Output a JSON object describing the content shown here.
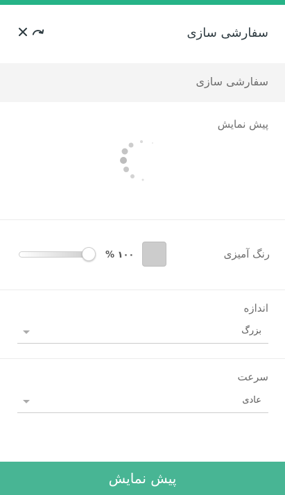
{
  "colors": {
    "accent": "#26b387",
    "button": "#48b594",
    "swatch": "#cccccc"
  },
  "header": {
    "title": "سفارشی سازی",
    "icons": [
      "close-icon",
      "redo-icon"
    ]
  },
  "section": {
    "title": "سفارشی سازی"
  },
  "preview": {
    "label": "پیش نمایش"
  },
  "colorize": {
    "label": "رنگ آمیزی",
    "percent_text": "% ۱۰۰",
    "level_percent": 100
  },
  "size": {
    "label": "اندازه",
    "value": "بزرگ"
  },
  "speed": {
    "label": "سرعت",
    "value": "عادی"
  },
  "footer": {
    "button_label": "پیش نمایش"
  }
}
